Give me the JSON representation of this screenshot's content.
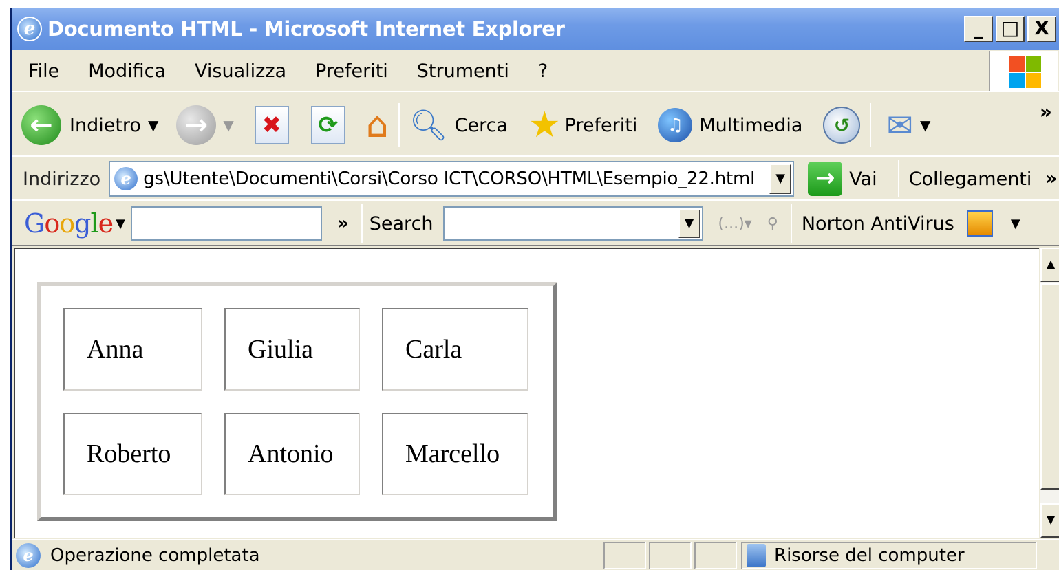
{
  "window": {
    "title": "Documento HTML - Microsoft Internet Explorer",
    "controls": [
      "_",
      "□",
      "X"
    ]
  },
  "menu": [
    "File",
    "Modifica",
    "Visualizza",
    "Preferiti",
    "Strumenti",
    "?"
  ],
  "toolbar": {
    "back_label": "Indietro",
    "search_label": "Cerca",
    "favorites_label": "Preferiti",
    "media_label": "Multimedia"
  },
  "address": {
    "label": "Indirizzo",
    "value": "gs\\Utente\\Documenti\\Corsi\\Corso ICT\\CORSO\\HTML\\Esempio_22.html",
    "go_label": "Vai",
    "links_label": "Collegamenti"
  },
  "googlebar": {
    "logo": "Google",
    "search_label": "Search",
    "norton_label": "Norton AntiVirus"
  },
  "table": {
    "rows": [
      [
        "Anna",
        "Giulia",
        "Carla"
      ],
      [
        "Roberto",
        "Antonio",
        "Marcello"
      ]
    ]
  },
  "status": {
    "text": "Operazione completata",
    "zone": "Risorse del computer"
  },
  "colors": {
    "titlebar": "#6e9be6",
    "chrome": "#ece9d8",
    "address_border": "#7f9db9"
  }
}
